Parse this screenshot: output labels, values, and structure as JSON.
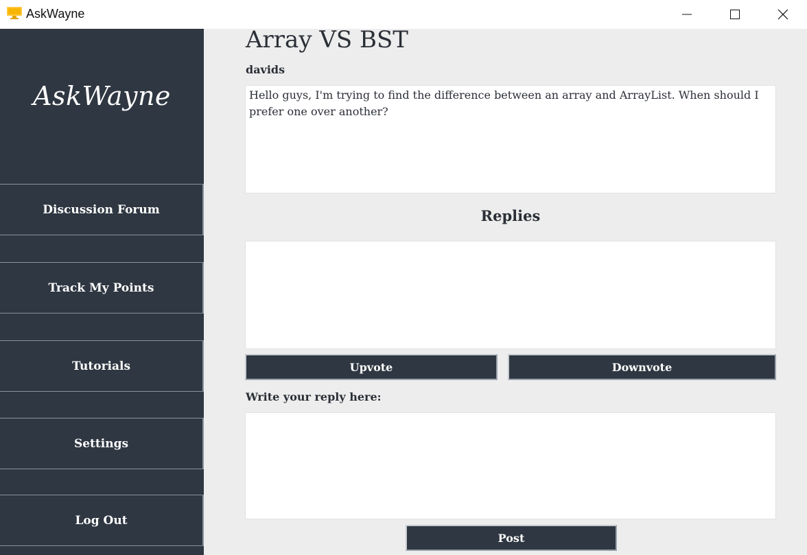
{
  "window": {
    "title": "AskWayne",
    "icon": "monitor-icon",
    "controls": [
      "minimize-icon",
      "maximize-icon",
      "close-icon"
    ],
    "accent_color": "#ffc83d"
  },
  "sidebar": {
    "logo": "AskWayne",
    "background": "#2f3742",
    "items": [
      {
        "label": "Discussion Forum"
      },
      {
        "label": "Track My Points"
      },
      {
        "label": "Tutorials"
      },
      {
        "label": "Settings"
      },
      {
        "label": "Log Out"
      }
    ]
  },
  "post": {
    "title": "Array VS BST",
    "author": "davids",
    "body": "Hello guys, I'm trying to find the difference between an array and ArrayList. When should I prefer one over another?"
  },
  "replies": {
    "heading": "Replies",
    "content": ""
  },
  "actions": {
    "upvote_label": "Upvote",
    "downvote_label": "Downvote"
  },
  "reply_form": {
    "label": "Write your reply here:",
    "value": "",
    "post_label": "Post"
  }
}
